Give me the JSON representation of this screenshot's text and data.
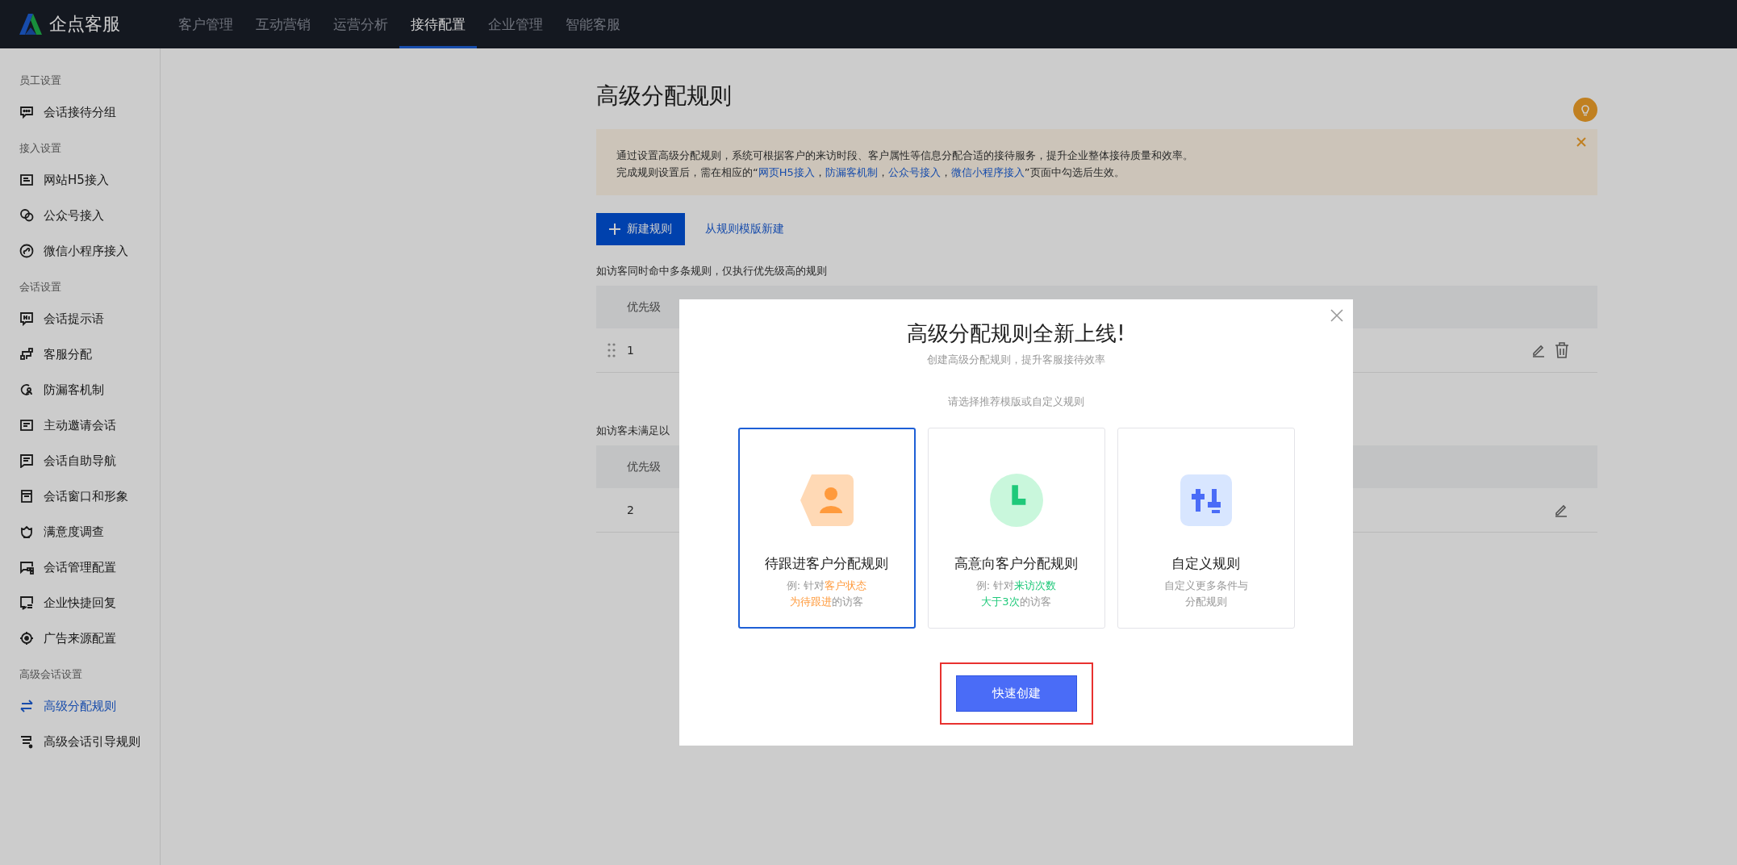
{
  "topbar": {
    "logo": "企点客服",
    "nav": [
      {
        "label": "客户管理",
        "selected": false
      },
      {
        "label": "互动营销",
        "selected": false
      },
      {
        "label": "运营分析",
        "selected": false
      },
      {
        "label": "接待配置",
        "selected": true
      },
      {
        "label": "企业管理",
        "selected": false
      },
      {
        "label": "智能客服",
        "selected": false
      }
    ]
  },
  "sidebar": {
    "groups": [
      {
        "title": "员工设置",
        "items": [
          {
            "label": "会话接待分组",
            "selected": false
          }
        ]
      },
      {
        "title": "接入设置",
        "items": [
          {
            "label": "网站H5接入",
            "selected": false
          },
          {
            "label": "公众号接入",
            "selected": false
          },
          {
            "label": "微信小程序接入",
            "selected": false
          }
        ]
      },
      {
        "title": "会话设置",
        "items": [
          {
            "label": "会话提示语",
            "selected": false
          },
          {
            "label": "客服分配",
            "selected": false
          },
          {
            "label": "防漏客机制",
            "selected": false
          },
          {
            "label": "主动邀请会话",
            "selected": false
          },
          {
            "label": "会话自助导航",
            "selected": false
          },
          {
            "label": "会话窗口和形象",
            "selected": false
          },
          {
            "label": "满意度调查",
            "selected": false
          },
          {
            "label": "会话管理配置",
            "selected": false
          },
          {
            "label": "企业快捷回复",
            "selected": false
          },
          {
            "label": "广告来源配置",
            "selected": false
          }
        ]
      },
      {
        "title": "高级会话设置",
        "items": [
          {
            "label": "高级分配规则",
            "selected": true
          },
          {
            "label": "高级会话引导规则",
            "selected": false
          }
        ]
      }
    ]
  },
  "page": {
    "title": "高级分配规则",
    "alert": {
      "line_1": "通过设置高级分配规则，系统可根据客户的来访时段、客户属性等信息分配合适的接待服务，提升企业整体接待质量和效率。",
      "line_2": {
        "before": "完成规则设置后，需在相应的“",
        "links": [
          {
            "text": "网页H5接入",
            "separator": "，"
          },
          {
            "text": "防漏客机制",
            "separator": "，"
          },
          {
            "text": "公众号接入",
            "separator": "，"
          },
          {
            "text": "微信小程序接入"
          }
        ],
        "after": "”页面中勾选后生效。"
      }
    },
    "new_button": "新建规则",
    "template_link": "从规则模版新建",
    "sections": [
      {
        "note": "如访客同时命中多条规则，仅执行优先级高的规则",
        "header": "优先级",
        "rows": [
          {
            "priority": "1",
            "draggable": true,
            "deletable": true
          }
        ]
      },
      {
        "note": "如访客未满足以",
        "header": "优先级",
        "rows": [
          {
            "priority": "2",
            "draggable": false,
            "deletable": false
          }
        ]
      }
    ]
  },
  "modal": {
    "title": "高级分配规则全新上线!",
    "subtitle": "创建高级分配规则，提升客服接待效率",
    "prompt": "请选择推荐模版或自定义规则",
    "cards": [
      {
        "kind": "person",
        "title": "待跟进客户分配规则",
        "selected": true,
        "color": "#ff9a3c",
        "desc": [
          [
            {
              "text": "例: 针对",
              "highlight": false
            },
            {
              "text": "客户状态",
              "highlight": true
            }
          ],
          [
            {
              "text": "为待跟进",
              "highlight": true
            },
            {
              "text": "的访客",
              "highlight": false
            }
          ]
        ]
      },
      {
        "kind": "clock",
        "title": "高意向客户分配规则",
        "selected": false,
        "color": "#1fc97a",
        "desc": [
          [
            {
              "text": "例: 针对",
              "highlight": false
            },
            {
              "text": "来访次数",
              "highlight": true
            }
          ],
          [
            {
              "text": "大于3次",
              "highlight": true
            },
            {
              "text": "的访客",
              "highlight": false
            }
          ]
        ]
      },
      {
        "kind": "custom",
        "title": "自定义规则",
        "selected": false,
        "color": "#4a6cf7",
        "desc": [
          [
            {
              "text": "自定义更多条件与",
              "highlight": false
            }
          ],
          [
            {
              "text": "分配规则",
              "highlight": false
            }
          ]
        ]
      }
    ],
    "button": "快速创建",
    "button_highlighted": true
  }
}
